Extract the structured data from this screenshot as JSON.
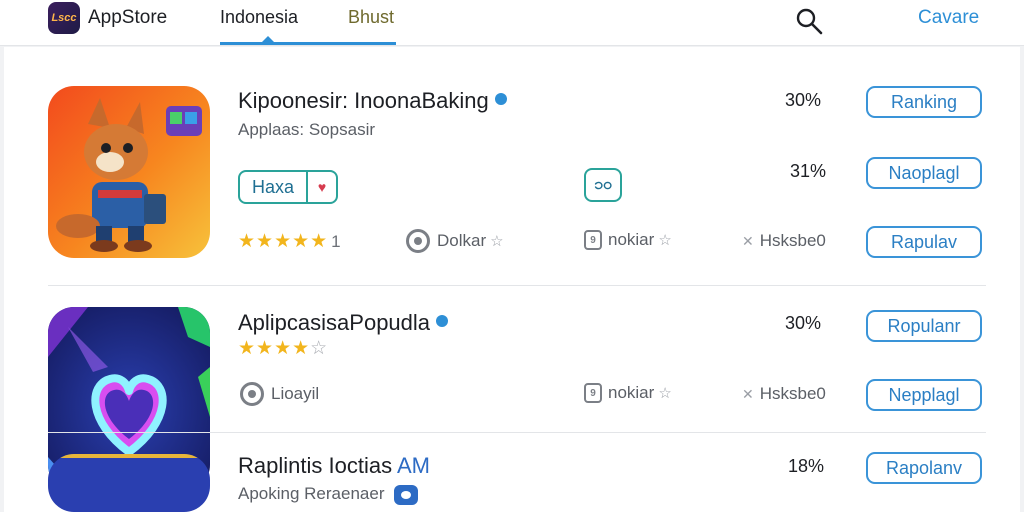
{
  "header": {
    "logo_text": "Lscc",
    "brand": "AppStore",
    "tabs": [
      {
        "label": "Indonesia",
        "active": true
      },
      {
        "label": "Bhust",
        "active": false
      }
    ],
    "search_icon": "search-icon",
    "action_link": "Cavare"
  },
  "apps": [
    {
      "title": "Kipoonesir: InoonaBaking",
      "verified": true,
      "subtitle": "Applaas: Sopsasir",
      "tag_label": "Haxa",
      "tag_side": "♥",
      "box_badge": "၁၀",
      "rating": 4.5,
      "stars_filled": "★★★★★",
      "stars_empty": "",
      "rating_count": "1",
      "meta1": "Dolkar",
      "meta2": "nokiar",
      "meta3": "Hsksbe0",
      "pct1": "30%",
      "pct2": "31%",
      "buttons": [
        "Ranking",
        "Naoplagl",
        "Rapulav"
      ]
    },
    {
      "title": "AplipcasisaPopudla",
      "verified": true,
      "subtitle": "",
      "rating": 4,
      "stars_filled": "★★★★",
      "stars_empty": "☆",
      "meta1": "Lioayil",
      "meta2": "nokiar",
      "meta3": "Hsksbe0",
      "pct1": "30%",
      "buttons": [
        "Ropulanr",
        "Nepplagl"
      ]
    },
    {
      "title": "Raplintis Ioctias",
      "title_suffix": "AM",
      "subtitle": "Apoking Reraenaer",
      "pct1": "18%",
      "buttons": [
        "Rapolanv"
      ]
    }
  ],
  "colors": {
    "accent": "#2d8fd6",
    "teal": "#2aa39a",
    "star": "#f2b51d"
  }
}
